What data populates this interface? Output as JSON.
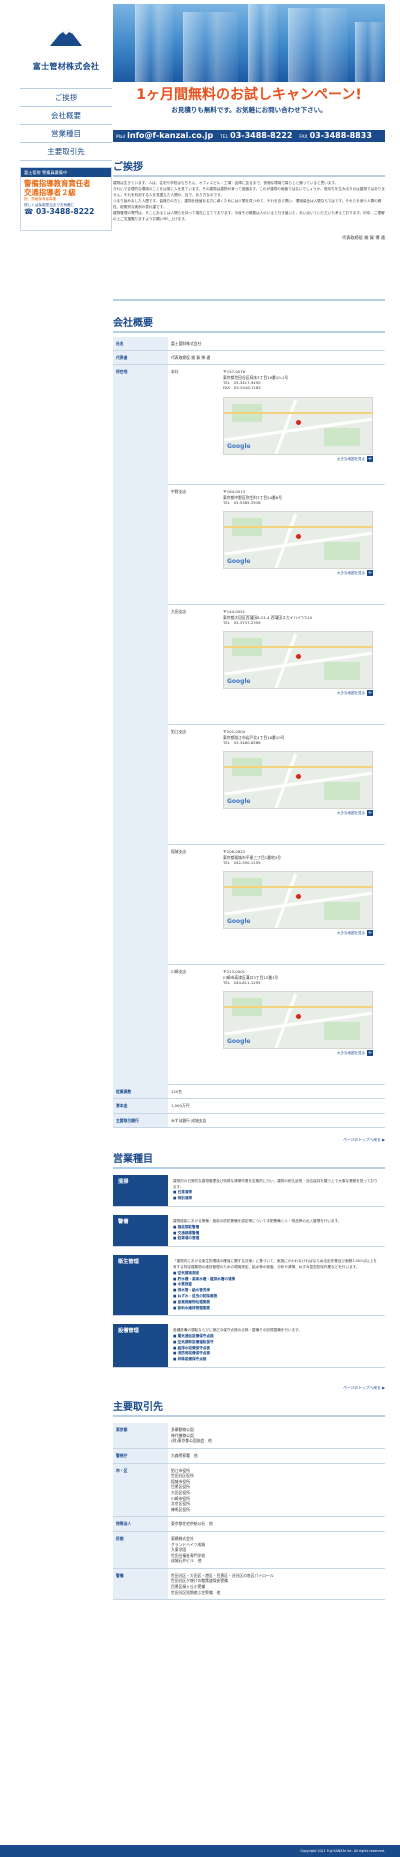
{
  "company": {
    "name": "富士管材株式会社"
  },
  "nav": {
    "items": [
      {
        "label": "ご挨拶"
      },
      {
        "label": "会社概要"
      },
      {
        "label": "営業種目"
      },
      {
        "label": "主要取引先"
      }
    ]
  },
  "side_banner": {
    "header": "富士管財 警備員募集中",
    "headline1": "警備指導教育責任者",
    "headline2": "交通指導者２級",
    "note": "他、資格保有者募集",
    "tel_label": "詳しくは採用担当までお気軽に",
    "tel": "03-3488-8222"
  },
  "campaign": {
    "title": "1ヶ月間無料のお試しキャンペーン!",
    "sub": "お見積りも無料です。お気軽にお問い合わせ下さい。",
    "mail_label": "Mail",
    "mail": "info@f-kanzai.co.jp",
    "tel_label": "TEL",
    "tel": "03-3488-8222",
    "fax_label": "FAX",
    "fax": "03-3488-8833"
  },
  "greeting": {
    "title": "ご挨拶",
    "paragraphs": [
      "建物は生きています。人は、住宅や学校はもちろん、オフィスビル・工場・倉庫に至るまで、快適な環境で暮らしと勝っていると思います。",
      "きれいで合理的な環境のことをは常に人を見ています。その建物は建物が身って価値ます。これが建物の価値ではないでしょうか。長持ちを生み出すのは建物ではありません。それを利用する人を見据えた人間の、目で、あり方なのです。",
      "つまり始めました人間です。皆様方の方と、建物を価値ある方に導くためには人間を見つめて、それを自ら問い、環境保全は人間ならではです。それらを使う人間の概性、総素別な実例の表れ重です。",
      "建物管理の専門は、そこにあるとは人間らを持って現在に立てております。今後その概要は人のいると行き届いた、あい近いていただいた考えております。何卒、ご理解の上ご支援賜りますようお願い申し上げます。"
    ],
    "sign": "代表取締役 雑 賀 博 通"
  },
  "profile": {
    "title": "会社概要",
    "rows_top": [
      {
        "k": "社名",
        "v": "富士管財株式会社"
      },
      {
        "k": "代表者",
        "v": "代表取締役 雑 賀 博 通"
      }
    ],
    "office_key": "所在地",
    "offices": [
      {
        "name": "本社",
        "zip": "〒157-0076",
        "addr": "東京都世田谷区岡本3丁目19番10-1号",
        "tel": "TEL　03-3417-9450",
        "fax": "FAX　03-3416-1185",
        "map_link": "大きな地図を見る"
      },
      {
        "name": "中野支店",
        "zip": "〒164-0013",
        "addr": "東京都中野区弥生町3丁目24番8号",
        "tel": "TEL　03-5385-3918",
        "fax": "",
        "map_link": "大きな地図を見る"
      },
      {
        "name": "大田支店",
        "zip": "〒144-0051",
        "addr": "東京都大田区西蒲田8-21-4 西蒲田スカイハイツ210",
        "tel": "TEL　03-3737-2359",
        "fax": "",
        "map_link": "大きな地図を見る"
      },
      {
        "name": "狛江支店",
        "zip": "〒201-0004",
        "addr": "東京都狛江市岩戸北4丁目18番10号",
        "tel": "TEL　03-3480-8566",
        "fax": "",
        "map_link": "大きな地図を見る"
      },
      {
        "name": "稲城支店",
        "zip": "〒206-0823",
        "addr": "東京都稲城市平尾三丁目1番地3号",
        "tel": "TEL　042-350-1159",
        "fax": "",
        "map_link": "大きな地図を見る"
      },
      {
        "name": "川崎支店",
        "zip": "〒213-0001",
        "addr": "川崎市高津区溝口3丁目13番1号",
        "tel": "TEL　044-811-1295",
        "fax": "",
        "map_link": "大きな地図を見る"
      }
    ],
    "rows_bottom": [
      {
        "k": "従業員数",
        "v": "120名"
      },
      {
        "k": "資本金",
        "v": "1,000万円"
      },
      {
        "k": "主要取引銀行",
        "v": "みずほ銀行 成城支店"
      }
    ]
  },
  "top_link": "ページのトップへ戻る",
  "services": {
    "title": "営業種目",
    "items": [
      {
        "k": "清掃",
        "desc": "建物内の日常的な建物管理及び特殊な清掃作業を定期的に行い、建物の耐久延長・品位保持を願う上で大事な業務を担っております。",
        "list": [
          "日常清掃",
          "特別清掃"
        ]
      },
      {
        "k": "警備",
        "desc": "建物施設における警備・施設の防犯警備を認定等について手配警備と人・物品等の出入管理を行います。",
        "list": [
          "施設常駐警備",
          "交通誘導警備",
          "駐車場の管理"
        ]
      },
      {
        "k": "衛生管理",
        "desc": "「建物内における衛生的環境の確保に関する法律」に基づいて、実施にかわれなければならぬ法定作業及び面積3,000㎡以上を有する特定建築物の維持管理のための環境測定、給水等の検査、分析や清掃、ねずみ昆虫防除作業などを行います。",
        "list": [
          "空気環境測定",
          "貯水槽・高架水槽・雑排水槽の清掃",
          "水質検査",
          "排水管・給水管洗浄",
          "ねずみ・昆虫の防除業務",
          "産業廃棄物処理業務",
          "飲料水維持管理業務"
        ]
      },
      {
        "k": "設備管理",
        "desc": "各種設備の運転ならびに適正な保守点検の点検・整備その記録整備を行います。",
        "list": [
          "電気通信設備保守点検",
          "空気調和設備運転保守",
          "給排水設備保守点検",
          "消防用設備保守点検",
          "昇降設備保守点検"
        ]
      }
    ]
  },
  "clients": {
    "title": "主要取引先",
    "rows": [
      {
        "k": "東京都",
        "v": [
          "多摩動物公園",
          "神代植物公園",
          "(財)東京都公園協会　他"
        ]
      },
      {
        "k": "警視庁",
        "v": [
          "大森警察署　他"
        ]
      },
      {
        "k": "市・区",
        "v": [
          "狛江市役所",
          "世田谷区役所",
          "稲城市役所",
          "目黒区役所",
          "大田区役所",
          "川崎市役所",
          "文京区役所",
          "練馬区役所"
        ]
      },
      {
        "k": "特殊法人",
        "v": [
          "東京都住宅供給公社　他"
        ]
      },
      {
        "k": "民間",
        "v": [
          "東横株式会社",
          "グランドハイツ成城",
          "大東学園",
          "世田谷福祉専門学校",
          "成城石井ビル　他"
        ]
      },
      {
        "k": "警備",
        "v": [
          "世田谷区・大田区・港区・目黒区・渋谷区の各区パトロール",
          "世田谷区夕焼けの散策道保安警備",
          "目黒区緑ヶ丘小警備",
          "世田谷区短期遊ぶ芝警備　他"
        ]
      }
    ]
  },
  "footer": {
    "copy": "Copyright 2011 Fuji KANZAI Inc. All rights reserved."
  }
}
